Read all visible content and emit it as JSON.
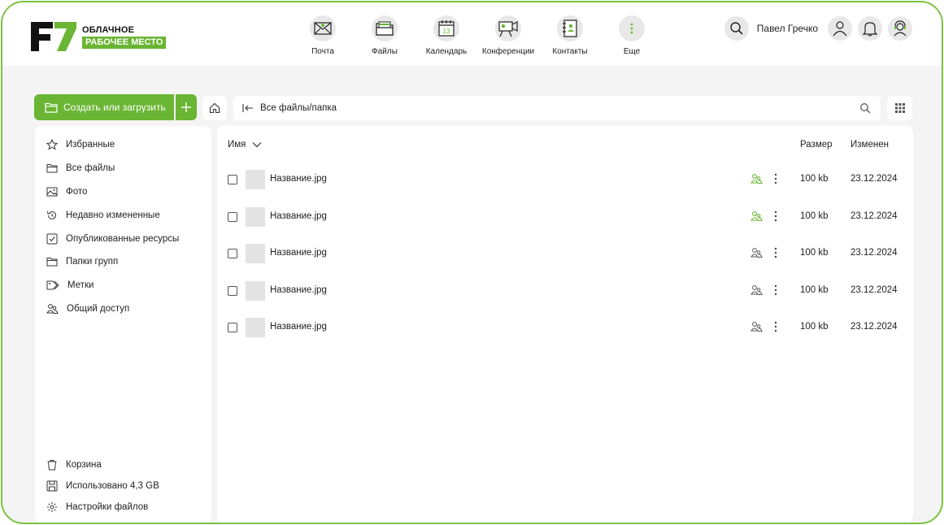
{
  "app": {
    "logo_line1": "ОБЛАЧНОЕ",
    "logo_line2": "РАБОЧЕЕ МЕСТО",
    "brand_color": "#6ab533",
    "frame_color": "#7cc242"
  },
  "nav": [
    {
      "label": "Почта",
      "icon": "mail-icon"
    },
    {
      "label": "Файлы",
      "icon": "files-icon"
    },
    {
      "label": "Календарь",
      "icon": "calendar-icon",
      "badge": "13"
    },
    {
      "label": "Конференции",
      "icon": "conference-icon"
    },
    {
      "label": "Контакты",
      "icon": "contacts-icon"
    },
    {
      "label": "Еще",
      "icon": "more-icon"
    }
  ],
  "user": {
    "name": "Павел Гречко"
  },
  "toolbar": {
    "create_label": "Создать или загрузить",
    "path": "Все файлы/папка"
  },
  "sidebar": {
    "items": [
      {
        "label": "Избранные",
        "icon": "star-icon"
      },
      {
        "label": "Все файлы",
        "icon": "folder-icon"
      },
      {
        "label": "Фото",
        "icon": "image-icon"
      },
      {
        "label": "Недавно измененные",
        "icon": "history-icon"
      },
      {
        "label": "Опубликованные ресурсы",
        "icon": "checkbox-icon"
      },
      {
        "label": "Папки групп",
        "icon": "folder-icon"
      },
      {
        "label": "Метки",
        "icon": "tag-icon"
      },
      {
        "label": "Общий доступ",
        "icon": "shared-users-icon"
      }
    ],
    "bottom": [
      {
        "label": "Корзина",
        "icon": "trash-icon"
      },
      {
        "label": "Использовано 4,3 GB",
        "icon": "disk-icon"
      },
      {
        "label": "Настройки файлов",
        "icon": "settings-icon"
      }
    ]
  },
  "table": {
    "headers": {
      "name": "Имя",
      "size": "Размер",
      "modified": "Изменен"
    },
    "rows": [
      {
        "name": "Название.jpg",
        "size": "100 kb",
        "modified": "23.12.2024",
        "shared": true
      },
      {
        "name": "Название.jpg",
        "size": "100 kb",
        "modified": "23.12.2024",
        "shared": true
      },
      {
        "name": "Название.jpg",
        "size": "100 kb",
        "modified": "23.12.2024",
        "shared": false
      },
      {
        "name": "Название.jpg",
        "size": "100 kb",
        "modified": "23.12.2024",
        "shared": false
      },
      {
        "name": "Название.jpg",
        "size": "100 kb",
        "modified": "23.12.2024",
        "shared": false
      }
    ]
  }
}
